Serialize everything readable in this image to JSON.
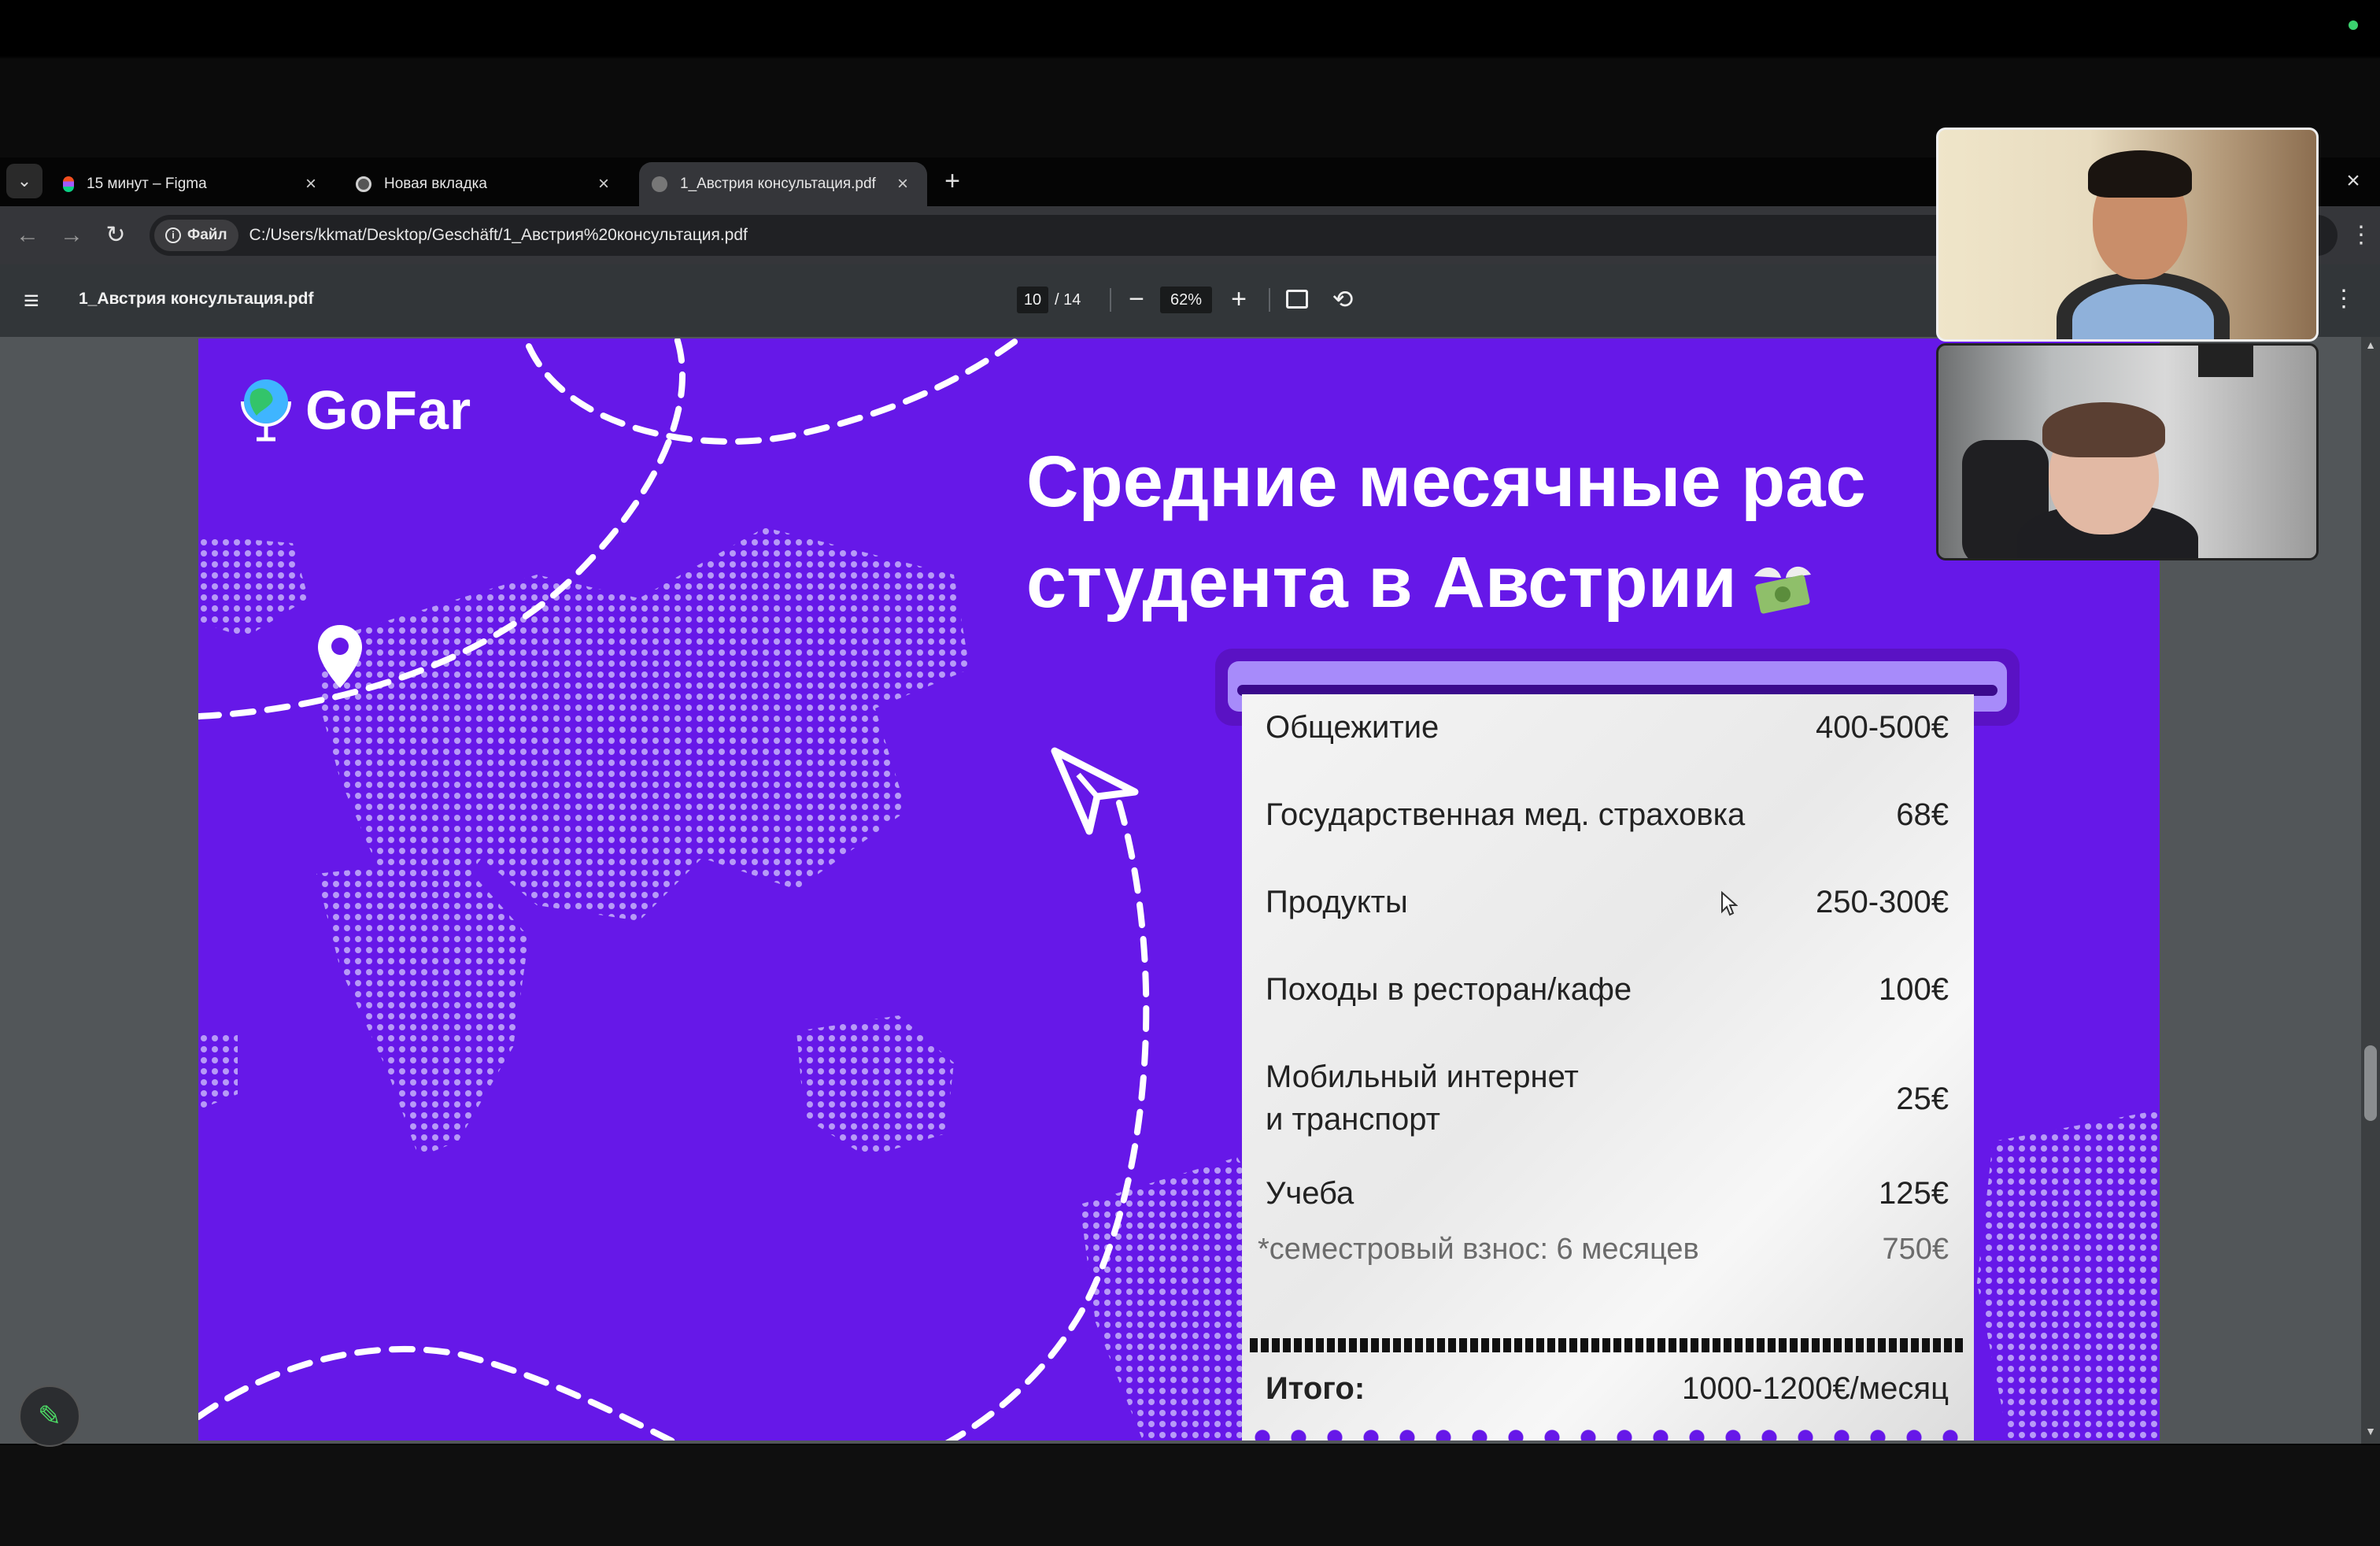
{
  "browser": {
    "tabs": [
      {
        "title": "15 минут – Figma",
        "favicon": "figma-icon",
        "active": false
      },
      {
        "title": "Новая вкладка",
        "favicon": "chrome-icon",
        "active": false
      },
      {
        "title": "1_Австрия консультация.pdf",
        "favicon": "globe-icon",
        "active": true
      }
    ],
    "file_chip": "Файл",
    "url": "C:/Users/kkmat/Desktop/Geschäft/1_Австрия%20консультация.pdf"
  },
  "pdf_viewer": {
    "title": "1_Австрия консультация.pdf",
    "current_page": "10",
    "page_total": "/ 14",
    "zoom": "62%"
  },
  "slide": {
    "logo_text": "GoFar",
    "title_line1": "Средние месячные рас",
    "title_line2": "студента в Австрии",
    "receipt": {
      "rows": [
        {
          "label": "Общежитие",
          "value": "400-500€"
        },
        {
          "label": "Государственная мед. страховка",
          "value": "68€"
        },
        {
          "label": "Продукты",
          "value": "250-300€"
        },
        {
          "label": "Походы в ресторан/кафе",
          "value": "100€"
        },
        {
          "label_line1": "Мобильный интернет",
          "label_line2": "и транспорт",
          "value": "25€"
        },
        {
          "label": "Учеба",
          "value": "125€"
        }
      ],
      "note_label": "*семестровый взнос: 6 месяцев",
      "note_value": "750€",
      "total_label": "Итого:",
      "total_value": "1000-1200€/месяц"
    }
  },
  "colors": {
    "slide_bg": "#6618e8",
    "receipt_paper": "#eeeeee",
    "accent_green": "#3bd16f"
  },
  "icons": [
    "tab-list-icon",
    "close-icon",
    "new-tab-icon",
    "back-icon",
    "forward-icon",
    "reload-icon",
    "info-icon",
    "menu-icon",
    "zoom-out-icon",
    "zoom-in-icon",
    "fit-page-icon",
    "rotate-icon",
    "more-icon",
    "location-pin-icon",
    "paper-plane-icon",
    "money-wings-icon",
    "pencil-icon",
    "mouse-cursor-icon"
  ]
}
